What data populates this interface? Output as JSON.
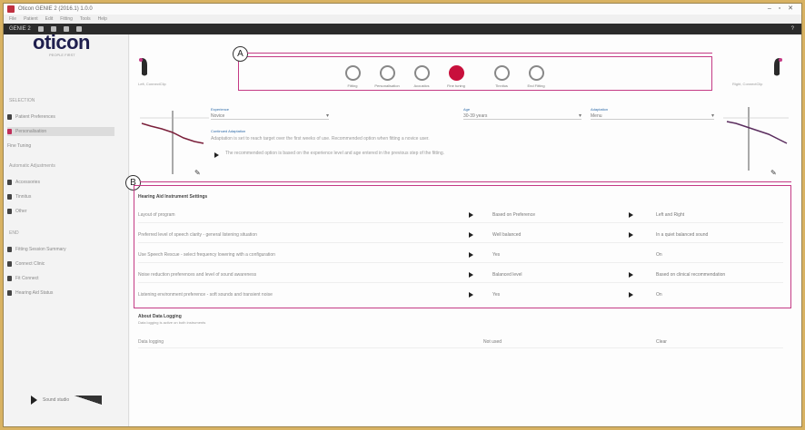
{
  "window": {
    "title": "Oticon GENIE 2 (2016.1) 1.0.0",
    "controls": "– ▫ ✕"
  },
  "menubar": [
    "File",
    "Patient",
    "Edit",
    "Fitting",
    "Tools",
    "Help"
  ],
  "toolbar": {
    "label": "GENIE 2",
    "right_label": "?"
  },
  "brand": {
    "logo": "oticon",
    "tagline": "PEOPLE FIRST"
  },
  "sidebar": {
    "section_select": "SELECTION",
    "items_top": [
      "Patient Preferences",
      "Personalisation",
      "Fine Tuning"
    ],
    "section_tools": "Automatic Adjustments",
    "items_mid": [
      "Accessories",
      "Tinnitus",
      "Other"
    ],
    "section_end": "END",
    "items_end": [
      "Fitting Session Summary",
      "Connect Clinic",
      "Fit Connect",
      "Hearing Aid Status"
    ],
    "player_label": "Sound studio"
  },
  "steps": [
    {
      "label": "Fitting",
      "active": false
    },
    {
      "label": "Personalisation",
      "active": false
    },
    {
      "label": "Acoustics",
      "active": false
    },
    {
      "label": "Fine tuning",
      "active": true
    },
    {
      "label": "Tinnitus",
      "active": false
    },
    {
      "label": "End Fitting",
      "active": false
    }
  ],
  "markers": {
    "a": "A",
    "b": "B"
  },
  "devices": {
    "left_label": "Left, ConnectClip",
    "right_label": "Right, ConnectClip"
  },
  "fields": {
    "f1_label": "Experience",
    "f1_value": "Novice",
    "f2_label": "Age",
    "f2_value": "30-39 years",
    "f3_label": "Adaptation",
    "f3_value": "Menu",
    "info_title": "Continued Adaptation",
    "info_text": "Adaptation is set to reach target over the first weeks of use. Recommended option when fitting a novice user.",
    "info_note": "The recommended option is based on the experience level and age entered in the previous step of the fitting."
  },
  "panel": {
    "title": "Hearing Aid Instrument Settings",
    "rows": [
      {
        "label": "Layout of program",
        "v1": "Based on Preference",
        "v2": "Left and Right"
      },
      {
        "label": "Preferred level of speech clarity - general listening situation",
        "v1": "Well balanced",
        "v2": "In a quiet balanced sound"
      },
      {
        "label": "Use Speech Rescue - select frequency lowering with a configuration",
        "v1": "Yes",
        "v2": "On"
      },
      {
        "label": "Noise reduction preferences and level of sound awareness",
        "v1": "Balanced level",
        "v2": "Based on clinical recommendation"
      },
      {
        "label": "Listening environment preference - soft sounds and transient noise",
        "v1": "Yes",
        "v2": "On"
      }
    ]
  },
  "section2": {
    "title": "About Data Logging",
    "sub": "Data logging is active on both instruments",
    "row_label": "Data logging",
    "v1": "Not used",
    "v2": "Clear"
  },
  "colors": {
    "accent": "#c43a85",
    "active_step": "#c8103c",
    "brand": "#1f1f4e"
  }
}
